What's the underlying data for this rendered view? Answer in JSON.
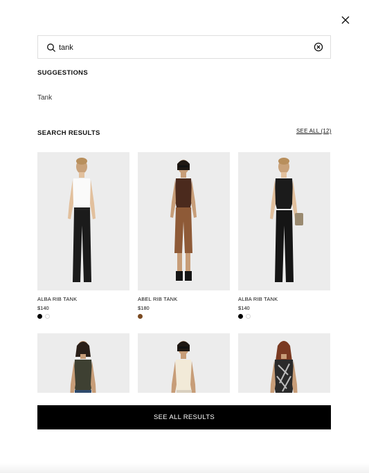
{
  "search": {
    "value": "tank"
  },
  "suggestions": {
    "title": "SUGGESTIONS",
    "items": [
      "Tank"
    ]
  },
  "results": {
    "title": "SEARCH RESULTS",
    "see_all_link": "SEE ALL (12)",
    "products": [
      {
        "name": "ALBA RIB TANK",
        "price": "$140",
        "swatches": [
          "#000000",
          "#ffffff"
        ]
      },
      {
        "name": "ABEL RIB TANK",
        "price": "$180",
        "swatches": [
          "#7a4a21"
        ]
      },
      {
        "name": "ALBA RIB TANK",
        "price": "$140",
        "swatches": [
          "#000000",
          "#ffffff"
        ]
      },
      {
        "name": "",
        "price": "",
        "swatches": []
      },
      {
        "name": "",
        "price": "",
        "swatches": []
      },
      {
        "name": "",
        "price": "",
        "swatches": []
      }
    ]
  },
  "see_all_button": "SEE ALL RESULTS",
  "colors": {
    "button_bg": "#000000",
    "image_bg": "#ececec"
  },
  "icons": [
    "close-icon",
    "search-icon",
    "clear-icon"
  ]
}
